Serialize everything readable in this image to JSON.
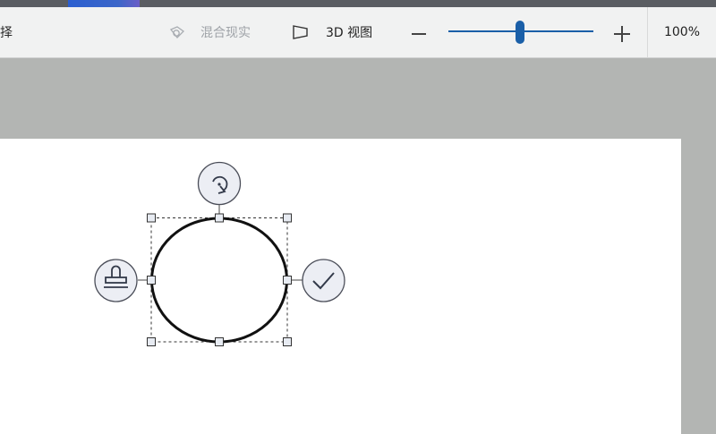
{
  "toolbar": {
    "select_label": "择",
    "mixed_reality_label": "混合现实",
    "view3d_label": "3D 视图",
    "zoom_level": "100%",
    "zoom_slider_value": 0.5
  },
  "canvas": {
    "selected_shape": "ellipse",
    "handles": [
      "rotate-icon",
      "stamp-icon",
      "checkmark-icon"
    ]
  },
  "colors": {
    "accent": "#1a5fa8",
    "toolbar_bg": "#f1f2f2",
    "workspace_bg": "#b3b5b3",
    "canvas_bg": "#ffffff"
  }
}
